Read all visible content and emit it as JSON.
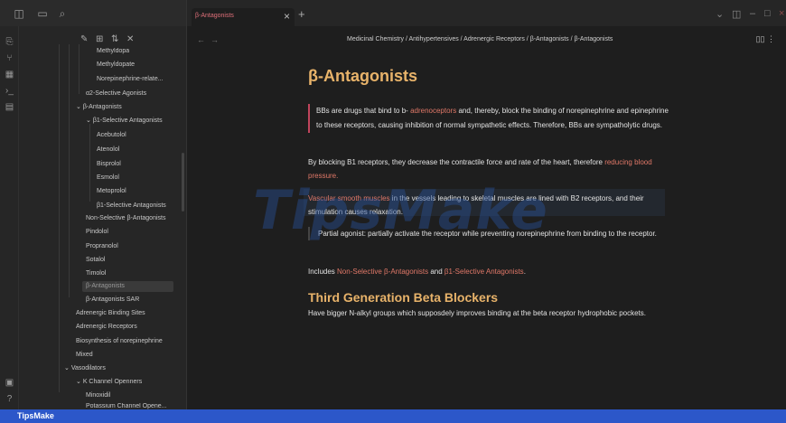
{
  "tab": {
    "title": "β-Antagonists"
  },
  "breadcrumb": "Medicinal Chemistry / Antihypertensives / Adrenergic Receptors / β-Antagonists / β-Antagonists",
  "sidebar": {
    "items": [
      "Methyldopa",
      "Methyldopate",
      "Norepinephrine-relate...",
      "α2-Selective Agonists",
      "β-Antagonists",
      "β1-Selective Antagonists",
      "Acebutolol",
      "Atenolol",
      "Bisprolol",
      "Esmolol",
      "Metoprolol",
      "β1-Selective Antagonists",
      "Non-Selective β-Antagonists",
      "Pindolol",
      "Propranolol",
      "Sotalol",
      "Timolol",
      "β-Antagonists",
      "β-Antagonists SAR",
      "Adrenergic Binding Sites",
      "Adrenergic Receptors",
      "Biosynthesis of norepinephrine",
      "Mixed",
      "Vasodilators",
      "K Channel Openners",
      "Minoxidil",
      "Potassium Channel Opene..."
    ]
  },
  "note": {
    "title": "β-Antagonists",
    "callout_1": "BBs are drugs that bind to b- ",
    "callout_link": "adrenoceptors",
    "callout_2": " and, thereby, block the binding of norepinephrine and epinephrine to these receptors, causing inhibition of normal sympathetic effects. Therefore, BBs are sympatholytic drugs.",
    "p1_a": "By blocking B1 receptors, they decrease the contractile force and rate of the heart, therefore ",
    "p1_link": "reducing blood pressure.",
    "p2_link": "Vascular smooth muscles",
    "p2_b": " in the vessels leading to skeletal muscles are lined with B2 receptors, and their stimulation causes relaxation.",
    "p3": "Partial agonist: partially activate the receptor while preventing norepinephrine from binding to the receptor.",
    "p4_a": "Includes ",
    "p4_link1": "Non-Selective β-Antagonists",
    "p4_and": " and ",
    "p4_link2": "β1-Selective Antagonists",
    "p4_end": ".",
    "h2": "Third Generation Beta Blockers",
    "p5": "Have bigger N-alkyl groups which supposdely improves binding at the beta receptor hydrophobic pockets."
  },
  "watermark": "TipsMake",
  "brand": "TipsMake",
  "icons": [
    "sidebar-toggle-icon",
    "folder-icon",
    "search-icon",
    "new-note-icon",
    "new-folder-icon",
    "sort-icon",
    "collapse-icon",
    "graph-icon",
    "template-icon",
    "terminal-icon",
    "calendar-icon",
    "vault-icon",
    "help-icon",
    "book-icon",
    "more-icon"
  ]
}
